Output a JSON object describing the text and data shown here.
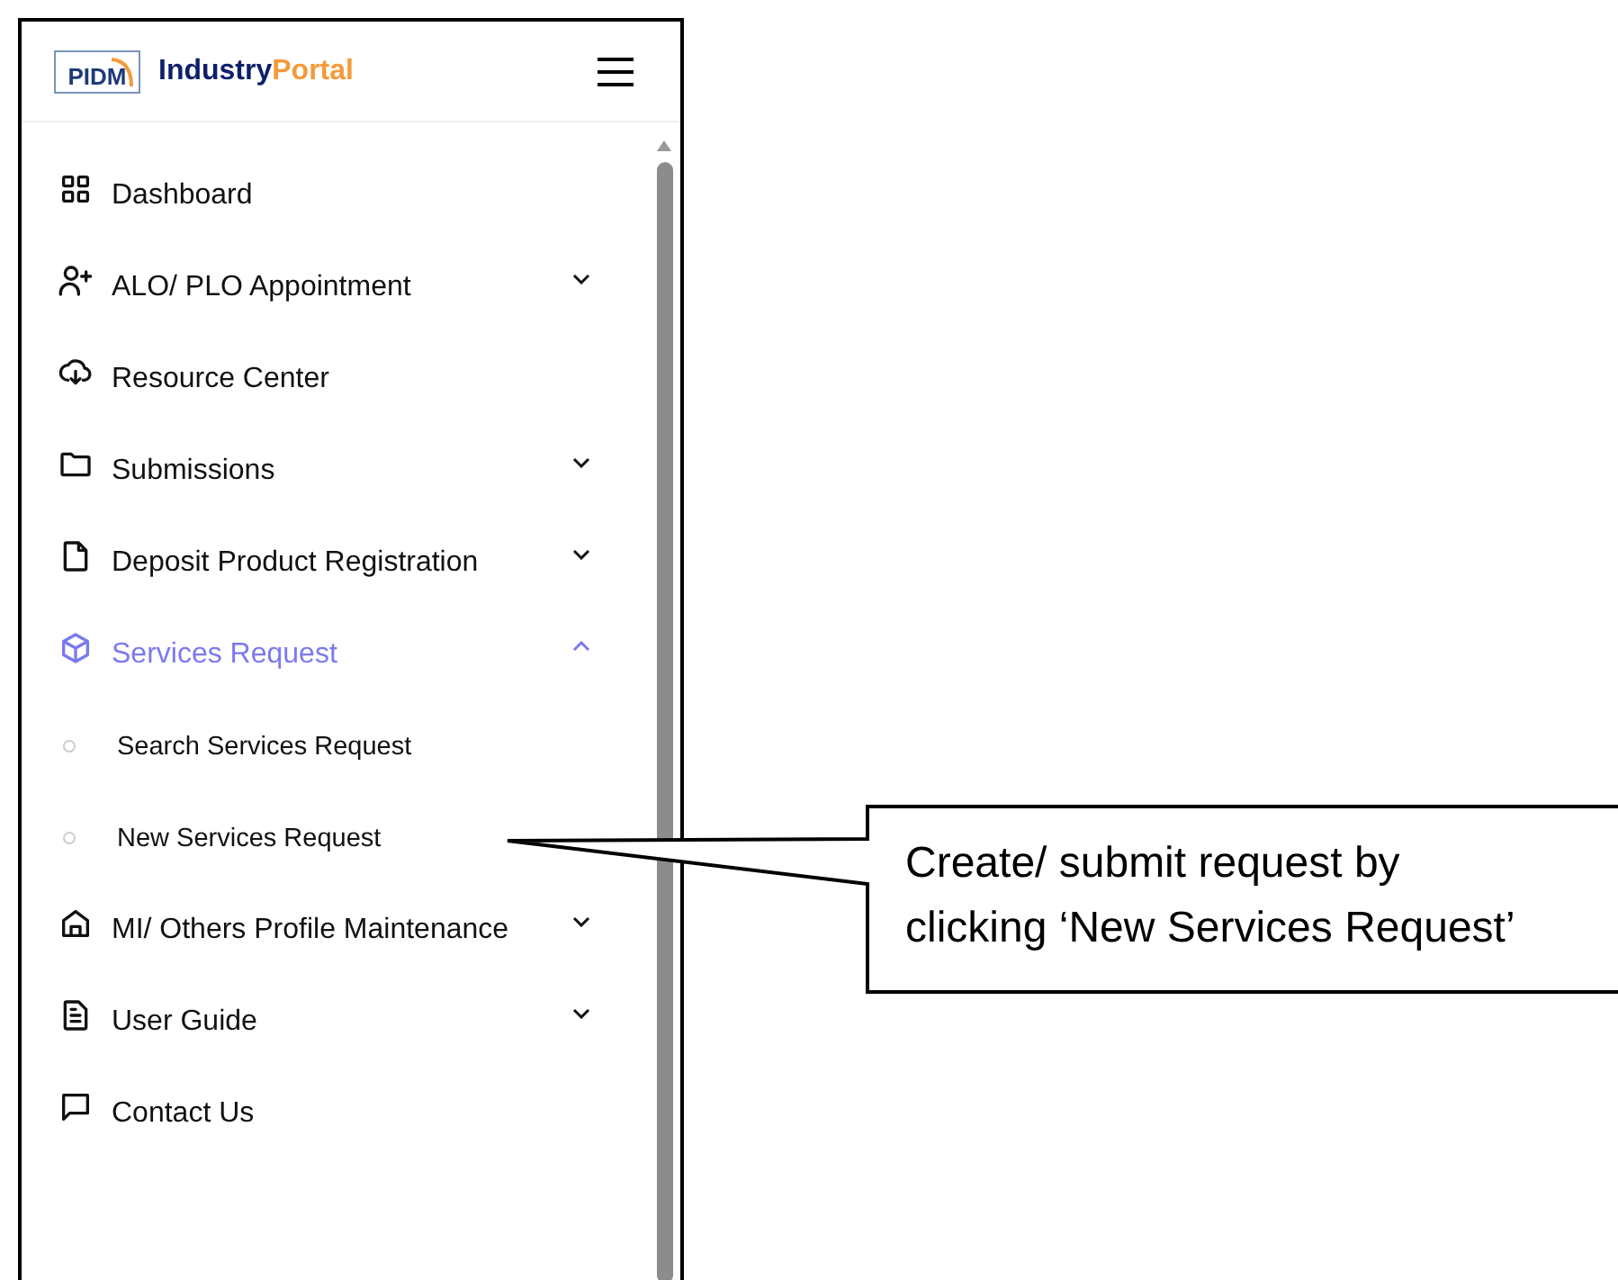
{
  "header": {
    "logo_text": "PIDM",
    "brand_name": "Industry",
    "brand_suffix": "Portal"
  },
  "sidebar": {
    "items": [
      {
        "label": "Dashboard",
        "kind": "link",
        "selected": false
      },
      {
        "label": "ALO/ PLO Appointment",
        "kind": "group",
        "expanded": false,
        "selected": false
      },
      {
        "label": "Resource Center",
        "kind": "link",
        "selected": false
      },
      {
        "label": "Submissions",
        "kind": "group",
        "expanded": false,
        "selected": false
      },
      {
        "label": "Deposit Product Registration",
        "kind": "group",
        "expanded": false,
        "selected": false
      },
      {
        "label": "Services Request",
        "kind": "group",
        "expanded": true,
        "selected": true,
        "children": [
          {
            "label": "Search Services Request",
            "selected": false
          },
          {
            "label": "New Services Request",
            "selected": false
          }
        ]
      },
      {
        "label": "MI/ Others Profile Maintenance",
        "kind": "group",
        "expanded": false,
        "selected": false
      },
      {
        "label": "User Guide",
        "kind": "group",
        "expanded": false,
        "selected": false
      },
      {
        "label": "Contact Us",
        "kind": "link",
        "selected": false
      }
    ]
  },
  "callout": {
    "text": "Create/ submit request by clicking ‘New Services Request’"
  }
}
